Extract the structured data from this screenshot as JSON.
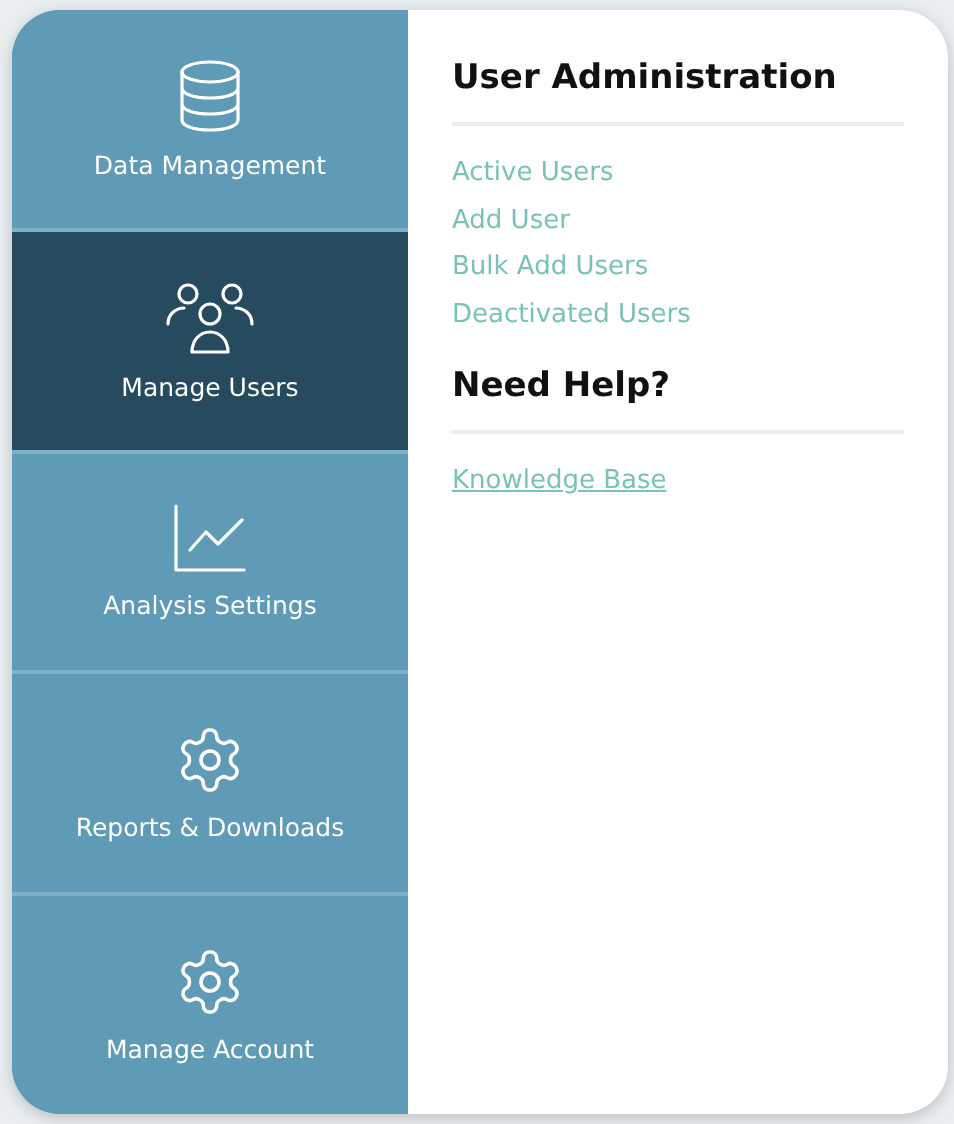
{
  "nav_items": [
    {
      "kind": "database",
      "label": "Data Management",
      "selected": false
    },
    {
      "kind": "users",
      "label": "Manage Users",
      "selected": true
    },
    {
      "kind": "chart",
      "label": "Analysis Settings",
      "selected": false
    },
    {
      "kind": "gear",
      "label": "Reports & Downloads",
      "selected": false
    },
    {
      "kind": "gear",
      "label": "Manage Account",
      "selected": false
    }
  ],
  "sections": [
    {
      "title": "User Administration",
      "links": [
        {
          "label": "Active Users",
          "underlined": false
        },
        {
          "label": "Add User",
          "underlined": false
        },
        {
          "label": "Bulk Add Users",
          "underlined": false
        },
        {
          "label": "Deactivated Users",
          "underlined": false
        }
      ]
    },
    {
      "title": "Need Help?",
      "links": [
        {
          "label": "Knowledge Base",
          "underlined": true
        }
      ]
    }
  ]
}
